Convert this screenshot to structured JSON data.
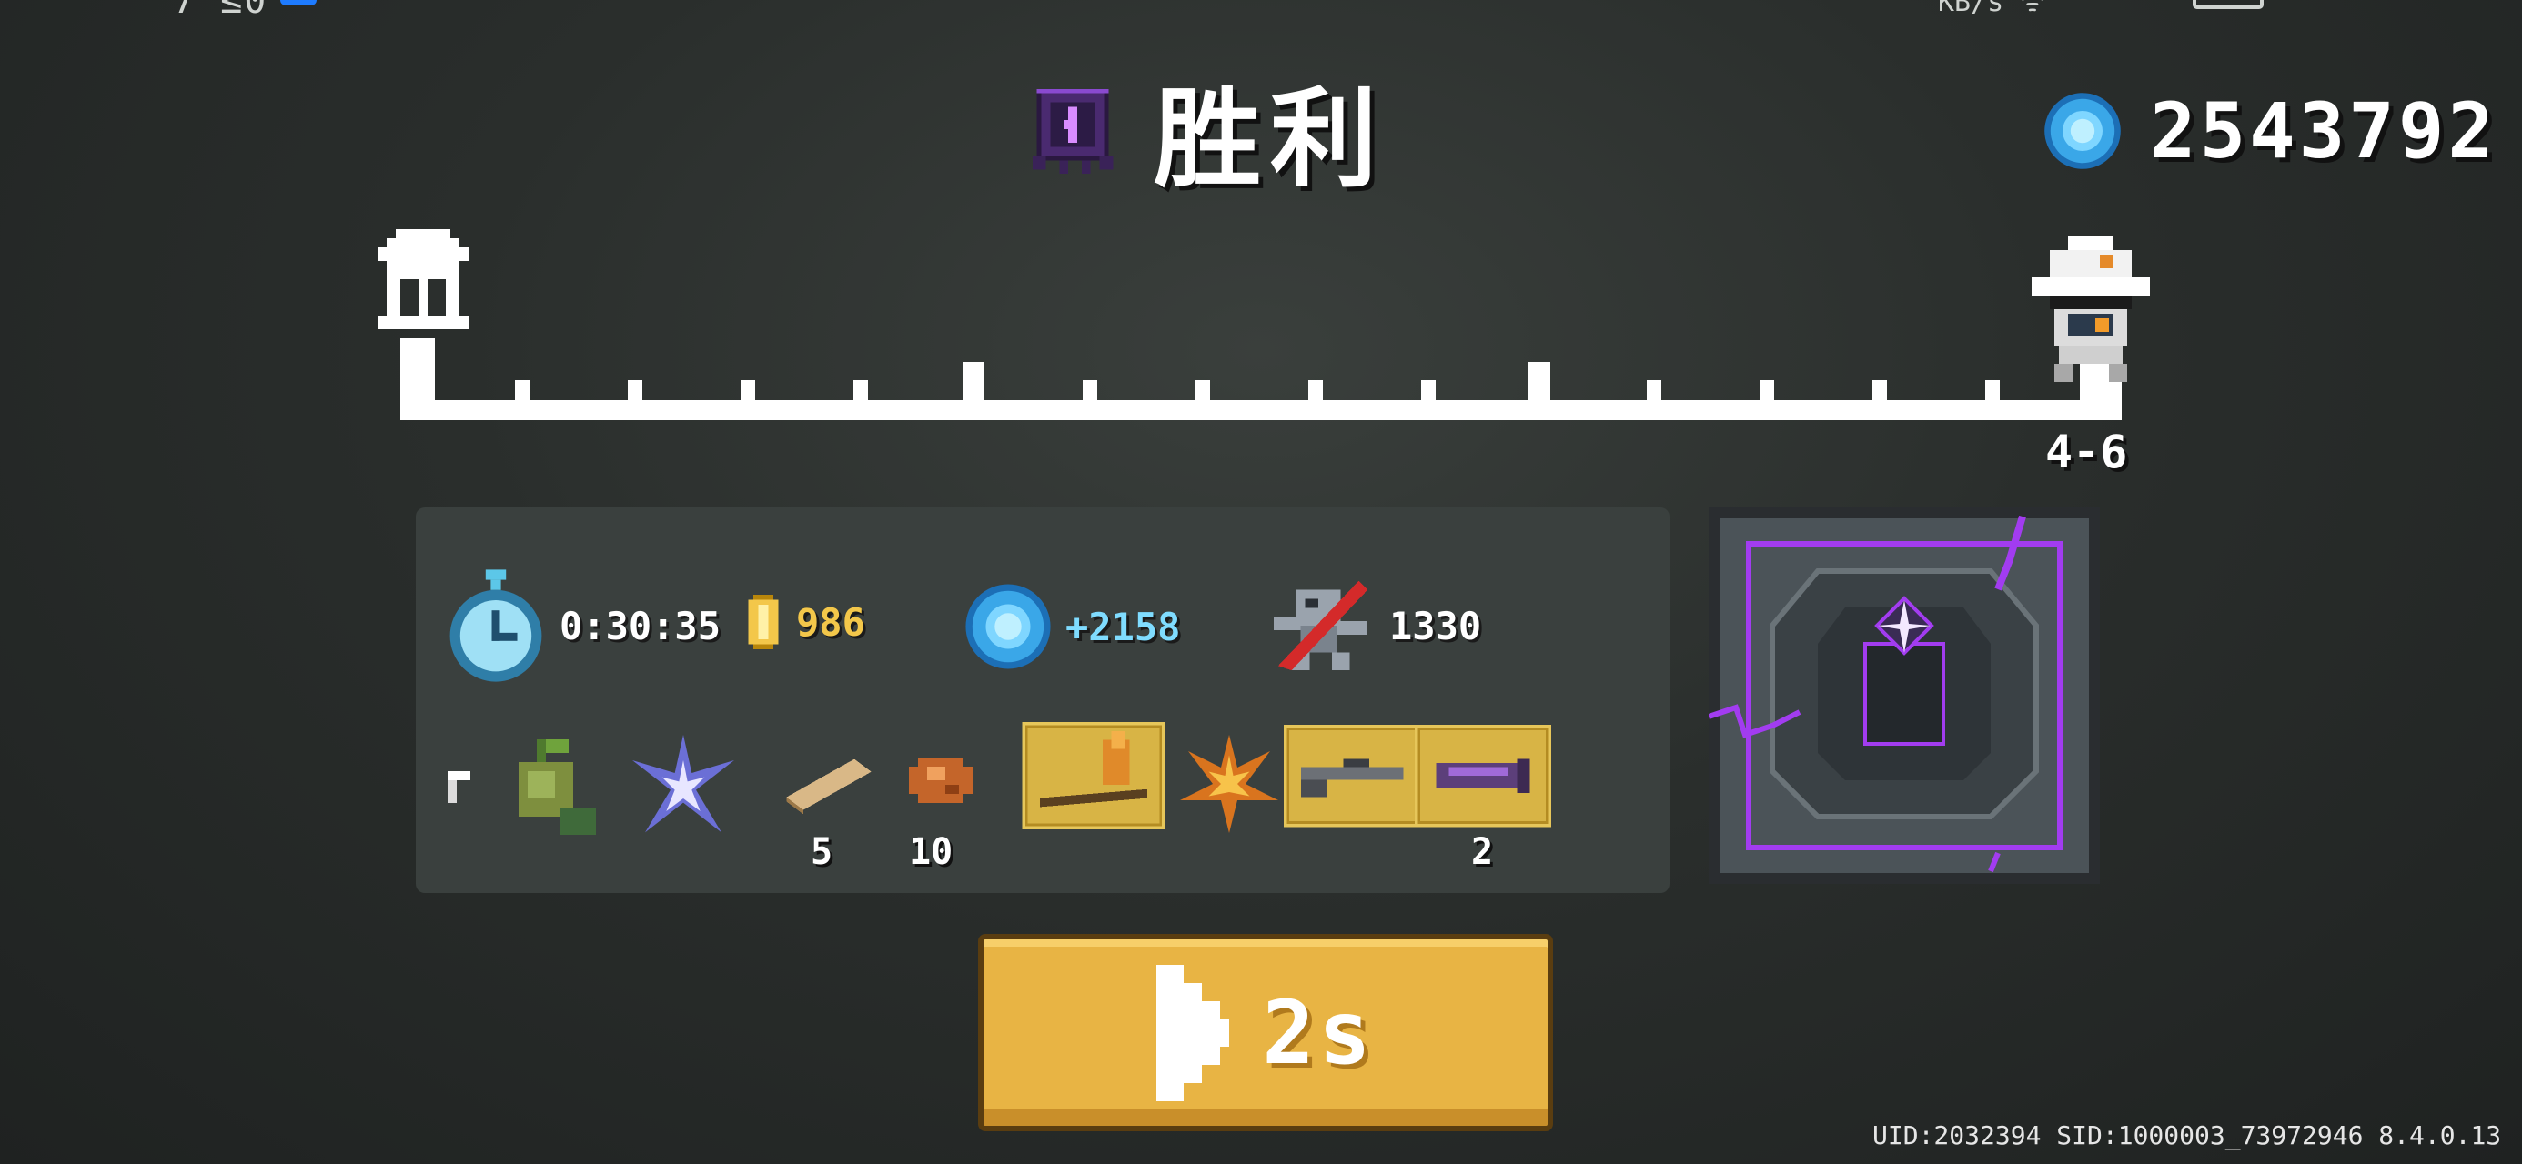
{
  "status_bar": {
    "left_text": "7 ≤0",
    "right_text": "KB/s ᯤ"
  },
  "header": {
    "title": "胜利",
    "boss_icon": "void-boss-icon",
    "gems": "2543792",
    "gem_icon": "blue-gem-icon"
  },
  "progress": {
    "start_icon": "home-icon",
    "end_icon": "knight-helmet-icon",
    "stage": "4-6",
    "fraction_complete": 1.0
  },
  "stats": {
    "time": "0:30:35",
    "gold": "986",
    "gems_earned": "+2158",
    "kills": "1330"
  },
  "items": [
    {
      "name": "leaf-shard-item-icon",
      "count": ""
    },
    {
      "name": "seed-pouch-item-icon",
      "count": ""
    },
    {
      "name": "crystal-star-item-icon",
      "count": ""
    },
    {
      "name": "wooden-plank-item-icon",
      "count": "5"
    },
    {
      "name": "ore-chunk-item-icon",
      "count": "10"
    },
    {
      "name": "blueprint-staff-item-icon",
      "count": ""
    },
    {
      "name": "fire-leaf-item-icon",
      "count": ""
    },
    {
      "name": "blueprint-rifle-item-icon",
      "count": ""
    },
    {
      "name": "blueprint-cannon-item-icon",
      "count": "2"
    }
  ],
  "continue_button": {
    "label": "2s"
  },
  "footer": {
    "uid": "UID:2032394 SID:1000003_73972946 8.4.0.13"
  },
  "colors": {
    "gold_text": "#f3c74a",
    "gem_text": "#7fdcff",
    "button": "#e8b444",
    "void_purple": "#a23cf0"
  }
}
